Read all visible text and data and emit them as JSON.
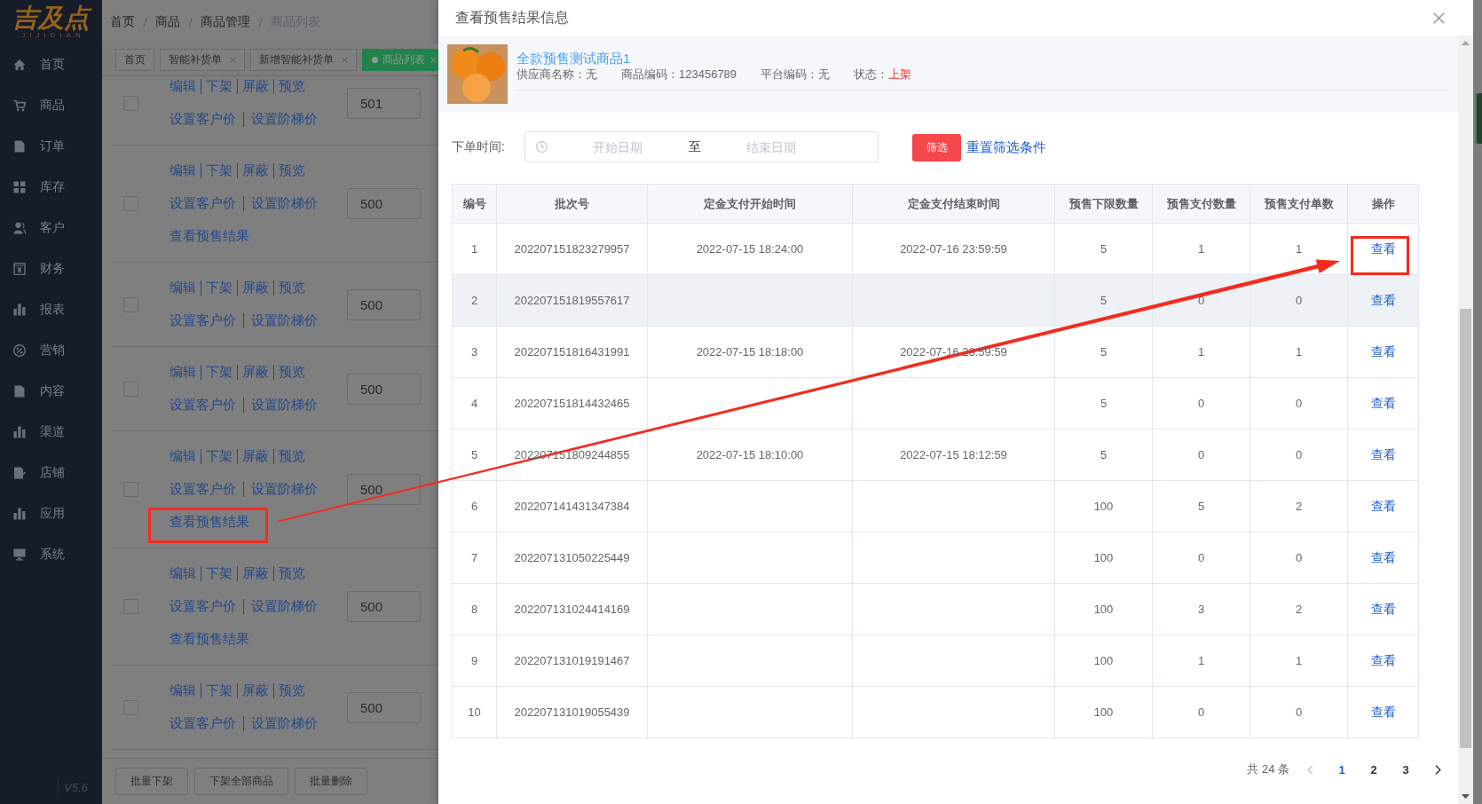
{
  "sidebar": {
    "logo": "吉及点",
    "logo_subtitle": "JIJIDIAN",
    "items": [
      "首页",
      "商品",
      "订单",
      "库存",
      "客户",
      "财务",
      "报表",
      "营销",
      "内容",
      "渠道",
      "店铺",
      "应用",
      "系统"
    ],
    "version": "V5.6"
  },
  "breadcrumb": [
    {
      "label": "首页",
      "current": false
    },
    {
      "label": "商品",
      "current": false
    },
    {
      "label": "商品管理",
      "current": false
    },
    {
      "label": "商品列表",
      "current": true
    }
  ],
  "tabs": [
    {
      "label": "首页",
      "closable": false,
      "selected": false
    },
    {
      "label": "智能补货单",
      "closable": true,
      "selected": false
    },
    {
      "label": "新增智能补货单",
      "closable": true,
      "selected": false
    },
    {
      "label": "商品列表",
      "closable": true,
      "selected": true
    }
  ],
  "product_list": {
    "rows": [
      {
        "checked": false,
        "actions": [
          "编辑",
          "下架",
          "屏蔽",
          "预览"
        ],
        "price_actions": [
          "设置客户价",
          "设置阶梯价"
        ],
        "value": "501"
      },
      {
        "checked": false,
        "actions": [
          "编辑",
          "下架",
          "屏蔽",
          "预览"
        ],
        "price_actions": [
          "设置客户价",
          "设置阶梯价"
        ],
        "presale_link": "查看预售结果",
        "value": "500"
      },
      {
        "checked": false,
        "actions": [
          "编辑",
          "下架",
          "屏蔽",
          "预览"
        ],
        "price_actions": [
          "设置客户价",
          "设置阶梯价"
        ],
        "value": "500"
      },
      {
        "checked": false,
        "actions": [
          "编辑",
          "下架",
          "屏蔽",
          "预览"
        ],
        "price_actions": [
          "设置客户价",
          "设置阶梯价"
        ],
        "value": "500"
      },
      {
        "checked": false,
        "actions": [
          "编辑",
          "下架",
          "屏蔽",
          "预览"
        ],
        "price_actions": [
          "设置客户价",
          "设置阶梯价"
        ],
        "presale_link": "查看预售结果",
        "value": "500"
      },
      {
        "checked": false,
        "actions": [
          "编辑",
          "下架",
          "屏蔽",
          "预览"
        ],
        "price_actions": [
          "设置客户价",
          "设置阶梯价"
        ],
        "presale_link": "查看预售结果",
        "value": "500"
      },
      {
        "checked": false,
        "actions": [
          "编辑",
          "下架",
          "屏蔽",
          "预览"
        ],
        "price_actions": [
          "设置客户价",
          "设置阶梯价"
        ],
        "value": "500"
      }
    ]
  },
  "bulk_actions": [
    "批量下架",
    "下架全部商品",
    "批量删除"
  ],
  "dialog": {
    "title": "查看预售结果信息",
    "product": {
      "name": "全款预售测试商品1",
      "fields": [
        {
          "label": "供应商名称：",
          "value": "无",
          "kind": "text"
        },
        {
          "label": "商品编码：",
          "value": "123456789",
          "kind": "text"
        },
        {
          "label": "平台编码：",
          "value": "无",
          "kind": "text"
        },
        {
          "label": "状态：",
          "value": "上架",
          "kind": "status"
        }
      ]
    },
    "filter": {
      "label": "下单时间:",
      "start_placeholder": "开始日期",
      "separator": "至",
      "end_placeholder": "结束日期",
      "submit": "筛选",
      "reset": "重置筛选条件"
    },
    "table": {
      "columns": [
        "编号",
        "批次号",
        "定金支付开始时间",
        "定金支付结束时间",
        "预售下限数量",
        "预售支付数量",
        "预售支付单数",
        "操作"
      ],
      "rows": [
        {
          "no": "1",
          "batch": "202207151823279957",
          "start": "2022-07-15 18:24:00",
          "end": "2022-07-16 23:59:59",
          "limit": "5",
          "paid_qty": "1",
          "paid_orders": "1",
          "action": "查看",
          "hovered": false
        },
        {
          "no": "2",
          "batch": "202207151819557617",
          "limit": "5",
          "paid_qty": "0",
          "paid_orders": "0",
          "action": "查看",
          "hovered": true
        },
        {
          "no": "3",
          "batch": "202207151816431991",
          "start": "2022-07-15 18:18:00",
          "end": "2022-07-16 23:59:59",
          "limit": "5",
          "paid_qty": "1",
          "paid_orders": "1",
          "action": "查看",
          "hovered": false
        },
        {
          "no": "4",
          "batch": "202207151814432465",
          "limit": "5",
          "paid_qty": "0",
          "paid_orders": "0",
          "action": "查看",
          "hovered": false
        },
        {
          "no": "5",
          "batch": "202207151809244855",
          "start": "2022-07-15 18:10:00",
          "end": "2022-07-15 18:12:59",
          "limit": "5",
          "paid_qty": "0",
          "paid_orders": "0",
          "action": "查看",
          "hovered": false
        },
        {
          "no": "6",
          "batch": "202207141431347384",
          "limit": "100",
          "paid_qty": "5",
          "paid_orders": "2",
          "action": "查看",
          "hovered": false
        },
        {
          "no": "7",
          "batch": "202207131050225449",
          "limit": "100",
          "paid_qty": "0",
          "paid_orders": "0",
          "action": "查看",
          "hovered": false
        },
        {
          "no": "8",
          "batch": "202207131024414169",
          "limit": "100",
          "paid_qty": "3",
          "paid_orders": "2",
          "action": "查看",
          "hovered": false
        },
        {
          "no": "9",
          "batch": "202207131019191467",
          "limit": "100",
          "paid_qty": "1",
          "paid_orders": "1",
          "action": "查看",
          "hovered": false
        },
        {
          "no": "10",
          "batch": "202207131019055439",
          "limit": "100",
          "paid_qty": "0",
          "paid_orders": "0",
          "action": "查看",
          "hovered": false
        }
      ]
    },
    "pagination": {
      "total": "共 24 条",
      "prev_disabled": true,
      "next_disabled": false,
      "pages": [
        {
          "label": "1",
          "selected": true
        },
        {
          "label": "2",
          "selected": false
        },
        {
          "label": "3",
          "selected": false
        }
      ]
    }
  }
}
